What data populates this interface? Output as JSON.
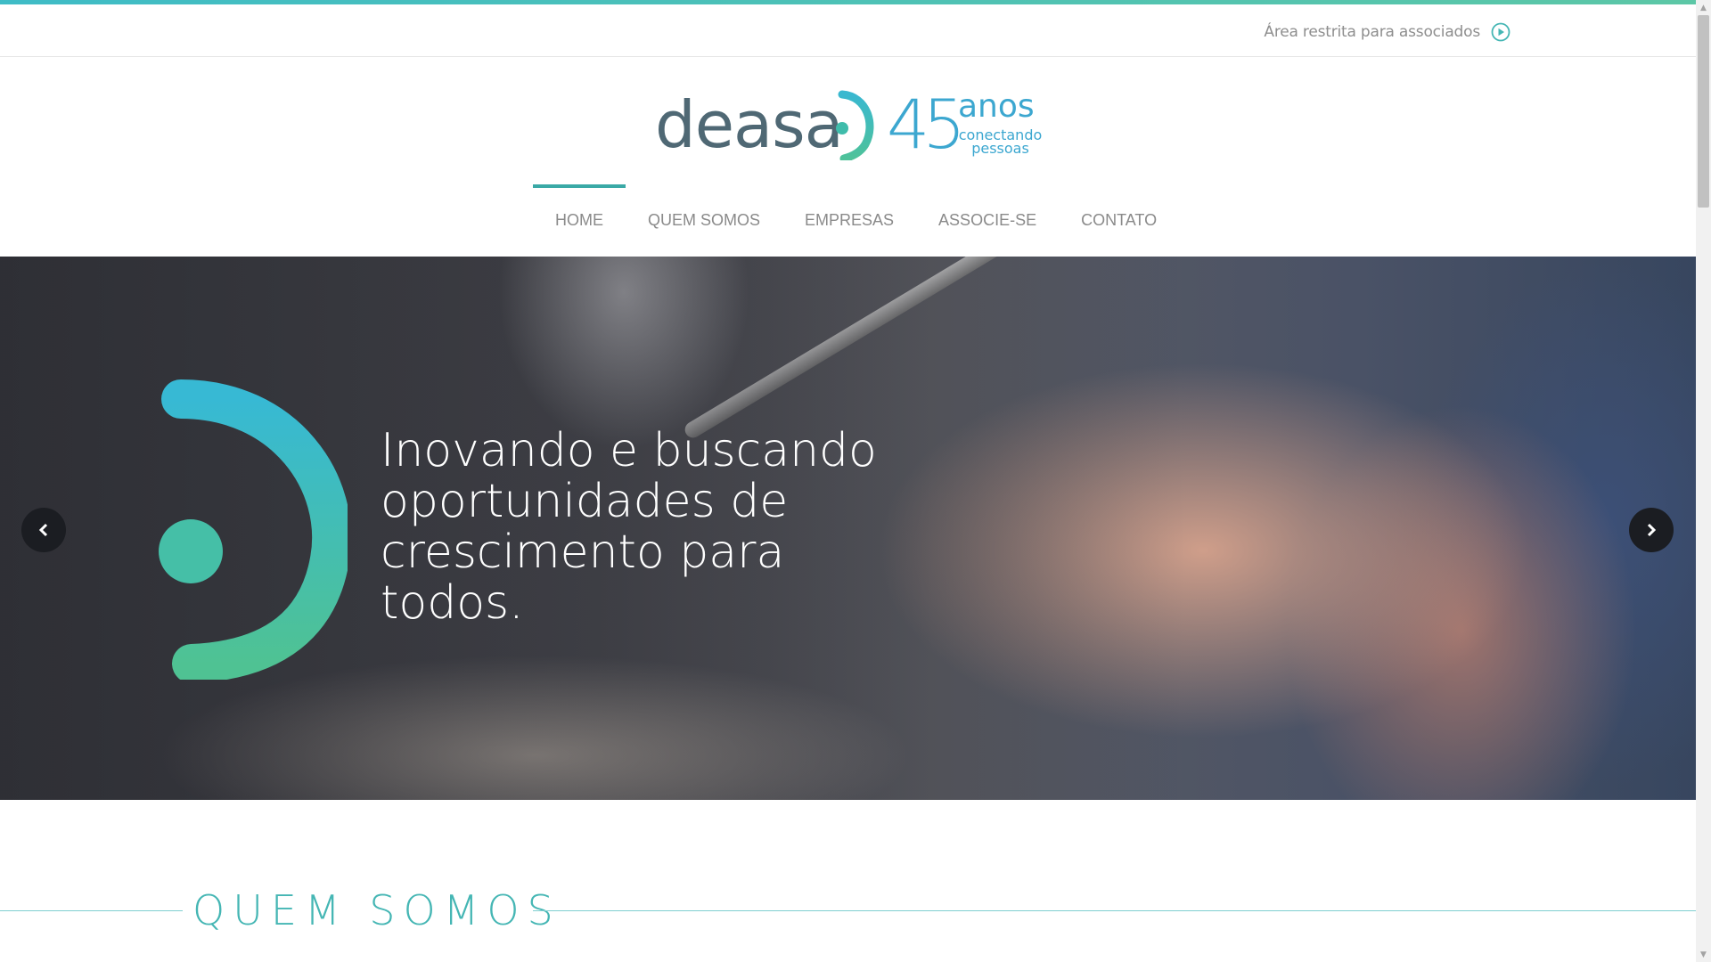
{
  "topbar": {
    "restricted_label": "Área restrita para associados",
    "restricted_icon": "play-circle-icon"
  },
  "logo": {
    "word": "deasa",
    "number": "45",
    "anos": "anos",
    "tagline_1": "conectando",
    "tagline_2": "pessoas"
  },
  "nav": {
    "items": [
      {
        "label": "HOME",
        "active": true
      },
      {
        "label": "QUEM SOMOS"
      },
      {
        "label": "EMPRESAS"
      },
      {
        "label": "ASSOCIE-SE"
      },
      {
        "label": "CONTATO"
      }
    ]
  },
  "hero": {
    "headline": "Inovando e buscando oportunidades de crescimento para todos.",
    "prev_icon": "chevron-left-icon",
    "next_icon": "chevron-right-icon"
  },
  "section": {
    "title": "QUEM SOMOS"
  },
  "colors": {
    "accent_teal": "#3aa9a6",
    "accent_blue": "#3ca7d0",
    "logo_gray": "#4f6874",
    "nav_text": "#8a8a8a"
  }
}
